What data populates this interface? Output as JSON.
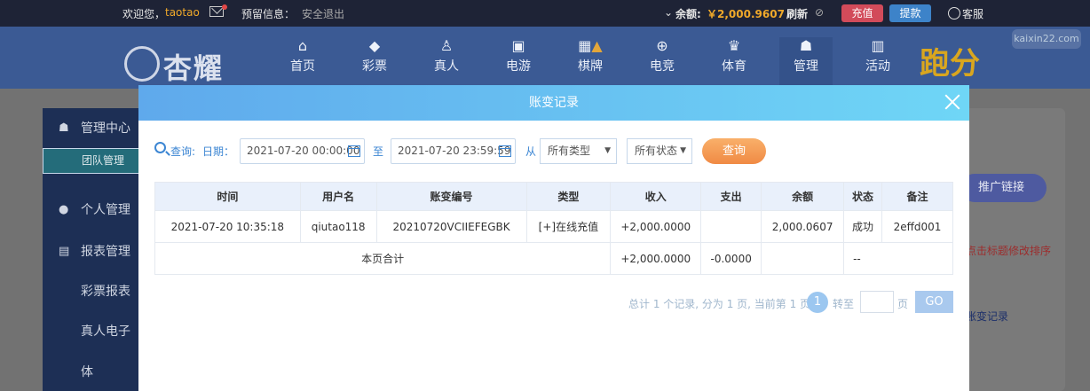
{
  "topbar": {
    "welcome": "欢迎您，",
    "username": "taotao",
    "reserve_info": "预留信息：",
    "logout": "安全退出",
    "balance_label": "余额:",
    "balance": "￥2,000.9607",
    "refresh": "刷新",
    "recharge": "充值",
    "withdraw": "提款",
    "service": "客服"
  },
  "nav": {
    "logo": "杏耀",
    "items": [
      {
        "label": "首页",
        "icon": "home-icon"
      },
      {
        "label": "彩票",
        "icon": "ticket-icon"
      },
      {
        "label": "真人",
        "icon": "person-icon"
      },
      {
        "label": "电游",
        "icon": "slot-icon"
      },
      {
        "label": "棋牌",
        "icon": "cards-icon"
      },
      {
        "label": "电竞",
        "icon": "gamepad-icon"
      },
      {
        "label": "体育",
        "icon": "trophy-icon"
      },
      {
        "label": "管理",
        "icon": "users-icon"
      },
      {
        "label": "活动",
        "icon": "gift-icon"
      }
    ],
    "paofen": "跑分",
    "watermark": "kaixin22.com"
  },
  "sidebar": {
    "items": [
      {
        "label": "管理中心"
      },
      {
        "label": "团队管理"
      },
      {
        "label": "个人管理"
      },
      {
        "label": "报表管理"
      },
      {
        "label": "彩票报表"
      },
      {
        "label": "真人电子体"
      }
    ]
  },
  "right": {
    "promo": "推广链接",
    "hint": "点击标题修改排序",
    "link": "账变记录"
  },
  "modal": {
    "title": "账变记录",
    "query_label": "查询:",
    "date_label": "日期：",
    "start_date": "2021-07-20 00:00:00",
    "to_label": "至",
    "end_date": "2021-07-20 23:59:59",
    "from_label": "从",
    "type_select": "所有类型",
    "status_select": "所有状态",
    "query_button": "查询",
    "table": {
      "headers": [
        "时间",
        "用户名",
        "账变编号",
        "类型",
        "收入",
        "支出",
        "余额",
        "状态",
        "备注"
      ],
      "rows": [
        [
          "2021-07-20 10:35:18",
          "qiutao118",
          "20210720VCIIEFEGBK",
          "[+]在线充值",
          "+2,000.0000",
          "",
          "2,000.0607",
          "成功",
          "2effd001"
        ]
      ],
      "summary": {
        "label": "本页合计",
        "income": "+2,000.0000",
        "expense": "-0.0000",
        "status": "--"
      }
    },
    "pager": {
      "info": "总计 1 个记录, 分为 1 页, 当前第 1 页",
      "current": "1",
      "goto": "转至",
      "page": "页",
      "go": "GO"
    }
  }
}
